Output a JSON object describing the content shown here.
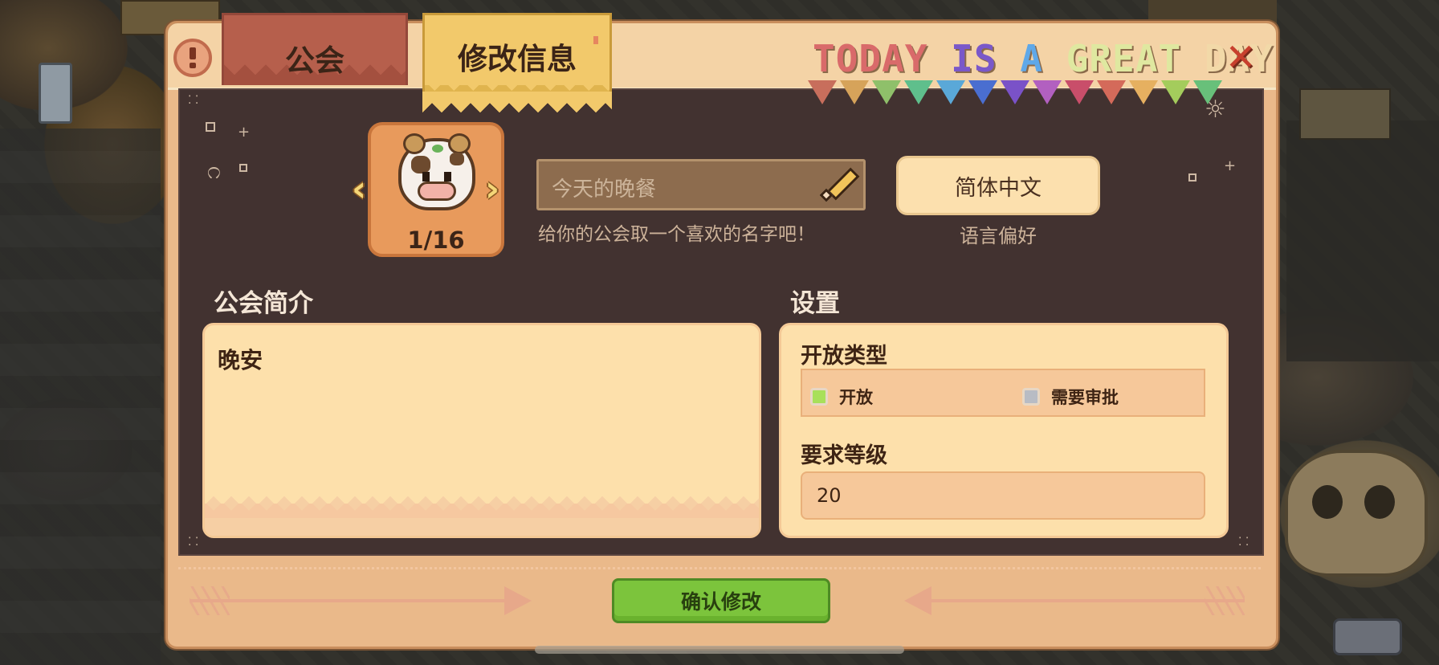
{
  "tabs": {
    "guild_label": "公会",
    "edit_label": "修改信息"
  },
  "banner": {
    "words": [
      {
        "text": "TODAY",
        "color": "#d96a6a"
      },
      {
        "text": "IS",
        "color": "#7a58c9"
      },
      {
        "text": "A",
        "color": "#5fa8e8"
      },
      {
        "text": "GREAT",
        "color": "#dfe8a0"
      },
      {
        "text": "DAY",
        "color": "#f2d9a8"
      }
    ],
    "flag_colors": [
      "#c86e5c",
      "#d6a35a",
      "#8fc06a",
      "#5fbf8c",
      "#5aa8d8",
      "#4a6ed0",
      "#7a52c8",
      "#b260c0",
      "#c94e6a",
      "#d46a5a",
      "#e6b060",
      "#a4cc5c",
      "#68c07a"
    ],
    "close_glyph": "✕"
  },
  "avatar": {
    "counter": "1/16",
    "prev_glyph": "‹",
    "next_glyph": "›"
  },
  "guild_name": {
    "placeholder": "今天的晚餐",
    "hint": "给你的公会取一个喜欢的名字吧！"
  },
  "language": {
    "button_label": "简体中文",
    "caption": "语言偏好"
  },
  "description": {
    "title": "公会简介",
    "text": "晚安"
  },
  "settings": {
    "title": "设置",
    "open_type_label": "开放类型",
    "options": [
      {
        "label": "开放",
        "selected": true,
        "color": "#a8e05a"
      },
      {
        "label": "需要审批",
        "selected": false,
        "color": "#b8bcc4"
      }
    ],
    "level_label": "要求等级",
    "level_value": "20"
  },
  "confirm": {
    "label": "确认修改"
  }
}
